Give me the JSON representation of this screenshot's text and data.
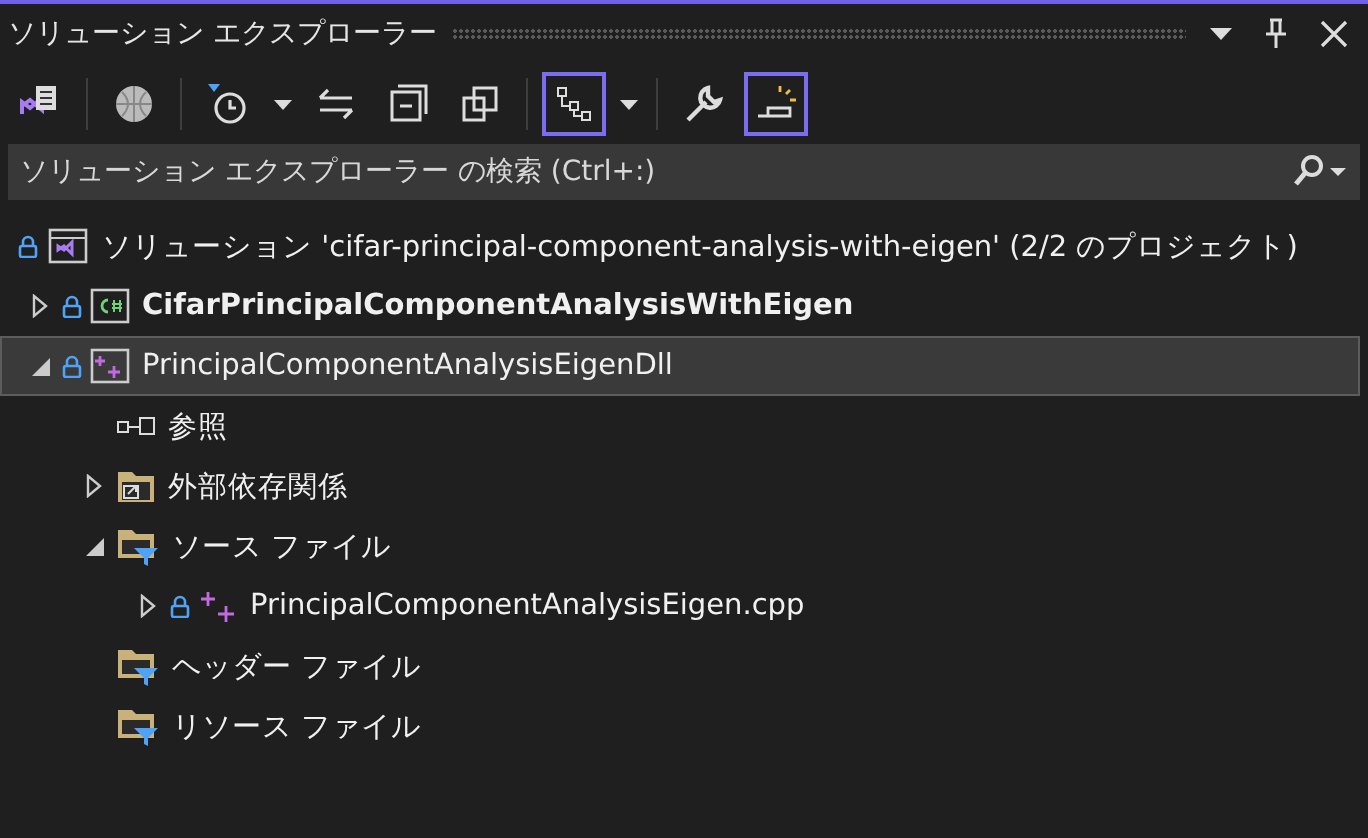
{
  "window": {
    "title": "ソリューション エクスプローラー"
  },
  "toolbar": [
    {
      "kind": "vs-solution",
      "on": false
    },
    {
      "kind": "divider"
    },
    {
      "kind": "globe",
      "on": false
    },
    {
      "kind": "divider"
    },
    {
      "kind": "pending",
      "on": false
    },
    {
      "kind": "caret"
    },
    {
      "kind": "sync",
      "on": false
    },
    {
      "kind": "collapse",
      "on": false
    },
    {
      "kind": "copies",
      "on": false
    },
    {
      "kind": "divider"
    },
    {
      "kind": "tree",
      "on": true
    },
    {
      "kind": "caret"
    },
    {
      "kind": "divider"
    },
    {
      "kind": "wrench",
      "on": false
    },
    {
      "kind": "preview",
      "on": true
    }
  ],
  "search": {
    "placeholder": "ソリューション エクスプローラー の検索 (Ctrl+:)"
  },
  "tree": [
    {
      "kind": "solution",
      "label": "ソリューション 'cifar-principal-component-analysis-with-eigen' (2/2 のプロジェクト)",
      "locked": true,
      "selected": false,
      "startup": false,
      "children": [
        {
          "kind": "csharp-project",
          "label": "CifarPrincipalComponentAnalysisWithEigen",
          "locked": true,
          "expanded": false,
          "selected": false,
          "startup": true
        },
        {
          "kind": "cpp-project",
          "label": "PrincipalComponentAnalysisEigenDll",
          "locked": true,
          "expanded": true,
          "selected": true,
          "startup": false,
          "children": [
            {
              "kind": "references",
              "label": "参照",
              "locked": false,
              "selected": false,
              "startup": false
            },
            {
              "kind": "external",
              "label": "外部依存関係",
              "locked": false,
              "expanded": false,
              "selected": false,
              "startup": false
            },
            {
              "kind": "filter",
              "label": "ソース ファイル",
              "locked": false,
              "expanded": true,
              "selected": false,
              "startup": false,
              "children": [
                {
                  "kind": "cpp-file",
                  "label": "PrincipalComponentAnalysisEigen.cpp",
                  "locked": true,
                  "expanded": false,
                  "selected": false,
                  "startup": false
                }
              ]
            },
            {
              "kind": "filter",
              "label": "ヘッダー ファイル",
              "locked": false,
              "selected": false,
              "startup": false
            },
            {
              "kind": "filter",
              "label": "リソース ファイル",
              "locked": false,
              "selected": false,
              "startup": false
            }
          ]
        }
      ]
    }
  ]
}
